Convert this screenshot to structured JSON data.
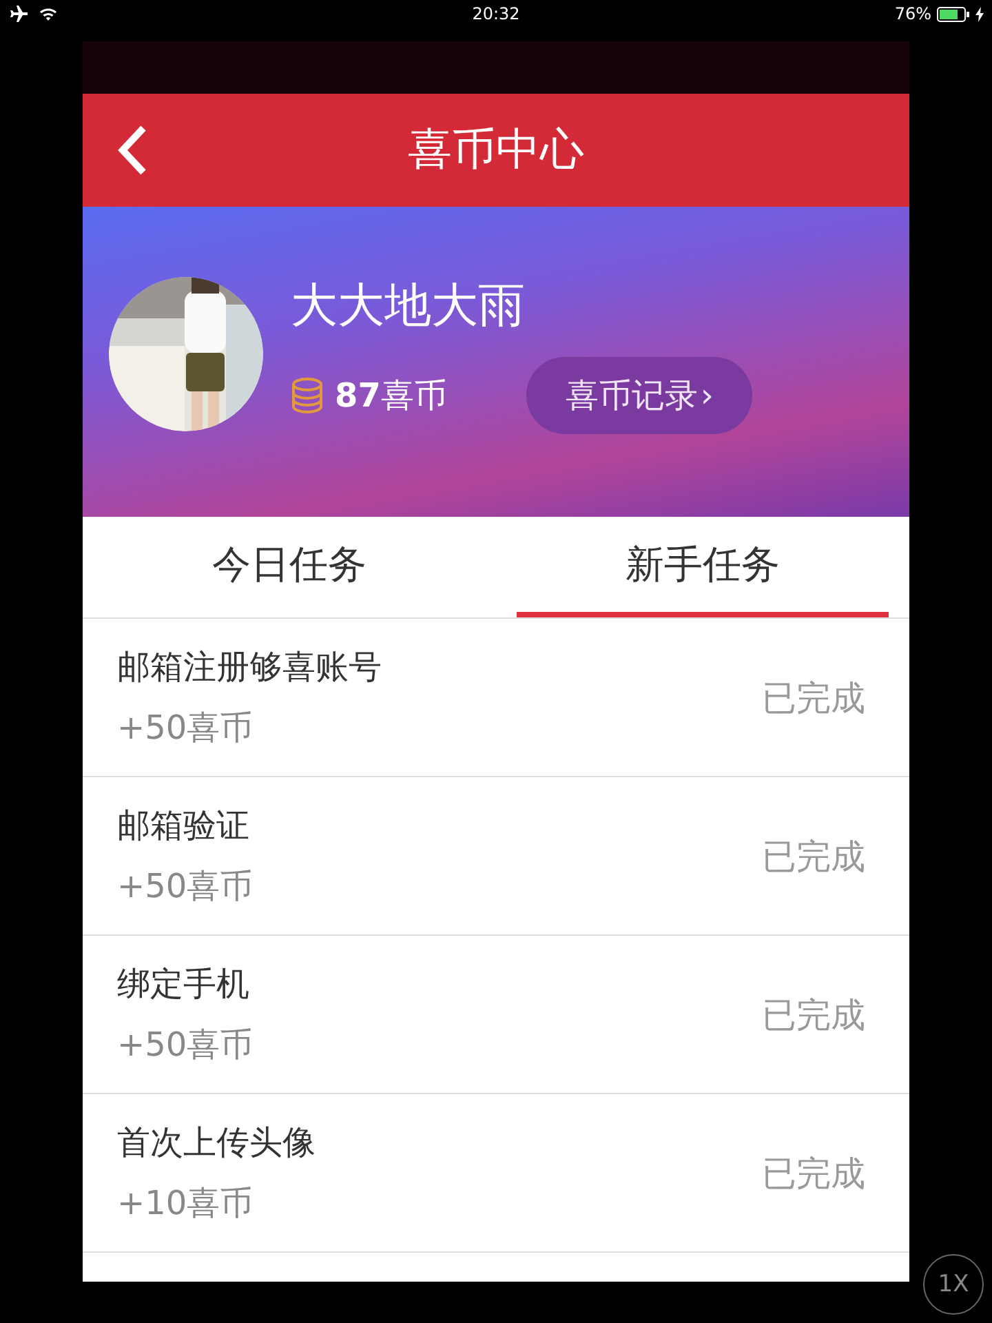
{
  "status_bar": {
    "time": "20:32",
    "battery_text": "76%"
  },
  "header": {
    "title": "喜币中心"
  },
  "profile": {
    "name": "大大地大雨",
    "coins": "87",
    "coin_unit": "喜币",
    "record_button": "喜币记录",
    "record_chevron": "›"
  },
  "tabs": [
    {
      "label": "今日任务",
      "selected": false
    },
    {
      "label": "新手任务",
      "selected": true
    }
  ],
  "tasks": [
    {
      "title": "邮箱注册够喜账号",
      "reward": "+50喜币",
      "status": "已完成"
    },
    {
      "title": "邮箱验证",
      "reward": "+50喜币",
      "status": "已完成"
    },
    {
      "title": "绑定手机",
      "reward": "+50喜币",
      "status": "已完成"
    },
    {
      "title": "首次上传头像",
      "reward": "+10喜币",
      "status": "已完成"
    }
  ],
  "zoom_button": "1X"
}
